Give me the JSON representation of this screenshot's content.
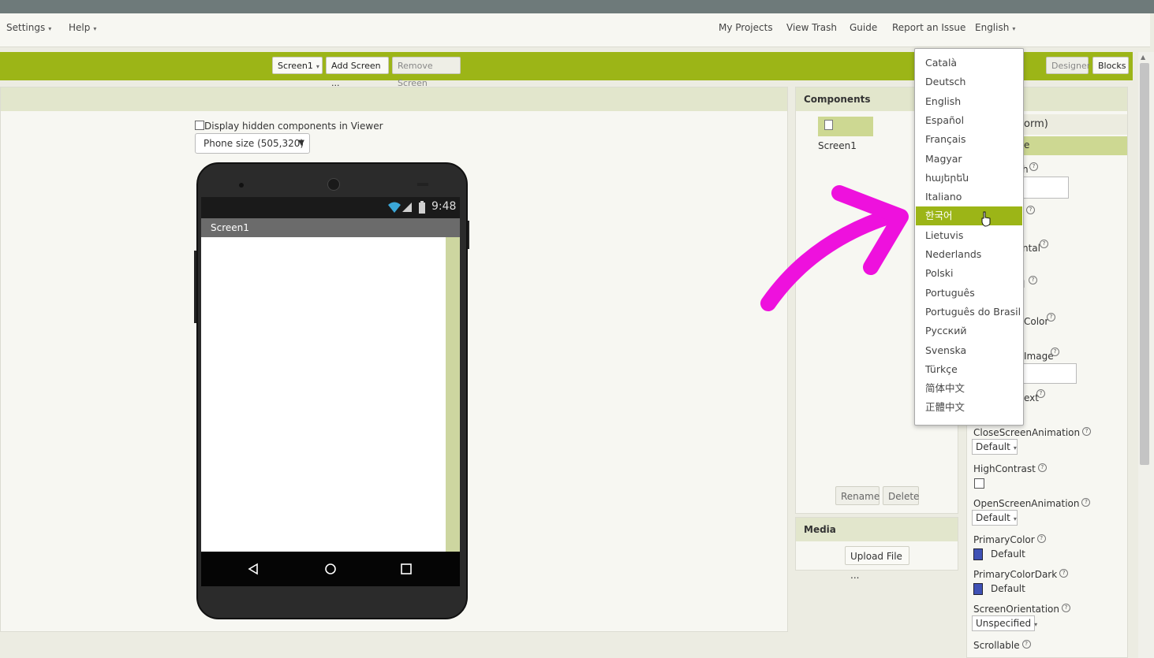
{
  "topbar": {
    "left_menus": [
      {
        "label": "Settings"
      },
      {
        "label": "Help"
      }
    ],
    "right_links": [
      {
        "label": "My Projects"
      },
      {
        "label": "View Trash"
      },
      {
        "label": "Guide"
      },
      {
        "label": "Report an Issue"
      }
    ],
    "language": "English"
  },
  "toolbar": {
    "screen_select": "Screen1",
    "add_screen": "Add Screen ...",
    "remove_screen": "Remove Screen",
    "designer": "Designer",
    "blocks": "Blocks"
  },
  "viewer": {
    "hidden_checkbox_label": "Display hidden components in Viewer",
    "size_select": "Phone size (505,320)",
    "phone": {
      "time": "9:48",
      "title": "Screen1"
    }
  },
  "components": {
    "title": "Components",
    "tree_item": "Screen1",
    "rename": "Rename",
    "delete": "Delete"
  },
  "media": {
    "title": "Media",
    "upload": "Upload File ..."
  },
  "properties": {
    "header_partial": "orm)",
    "subheader_partial": "e",
    "fragments": [
      "h",
      "ntal",
      "l",
      "Color",
      "Image",
      "ext"
    ],
    "items": [
      {
        "label": "CloseScreenAnimation",
        "value": "Default"
      },
      {
        "label": "HighContrast"
      },
      {
        "label": "OpenScreenAnimation",
        "value": "Default"
      },
      {
        "label": "PrimaryColor",
        "value": "Default"
      },
      {
        "label": "PrimaryColorDark",
        "value": "Default"
      },
      {
        "label": "ScreenOrientation",
        "value": "Unspecified"
      },
      {
        "label": "Scrollable"
      }
    ],
    "swatch_color": "#3f51b5"
  },
  "language_menu": {
    "selected_index": 8,
    "items": [
      "Català",
      "Deutsch",
      "English",
      "Español",
      "Français",
      "Magyar",
      "հայերեն",
      "Italiano",
      "한국어",
      "Lietuvis",
      "Nederlands",
      "Polski",
      "Português",
      "Português do Brasil",
      "Русский",
      "Svenska",
      "Türkçe",
      "简体中文",
      "正體中文"
    ]
  },
  "colors": {
    "accent_green": "#9cb517",
    "annotation_arrow": "#ee11dd"
  }
}
